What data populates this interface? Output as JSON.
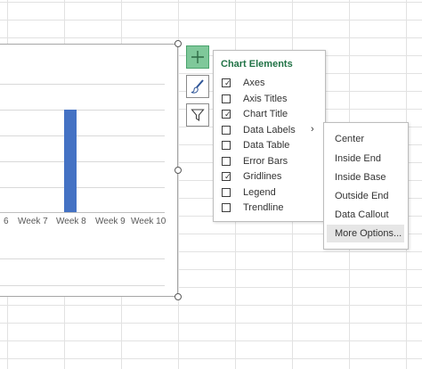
{
  "chart": {
    "x_ticks": [
      "6",
      "Week 7",
      "Week 8",
      "Week 9",
      "Week 10"
    ],
    "bar_color": "#4472c4",
    "bar_category": "Week 8"
  },
  "side_buttons": [
    {
      "name": "chart-elements-button",
      "icon": "plus-icon",
      "active": true
    },
    {
      "name": "chart-styles-button",
      "icon": "paintbrush-icon",
      "active": false
    },
    {
      "name": "chart-filters-button",
      "icon": "funnel-icon",
      "active": false
    }
  ],
  "panel": {
    "title": "Chart Elements",
    "title_color": "#217346",
    "items": [
      {
        "label": "Axes",
        "checked": true,
        "highlight": true
      },
      {
        "label": "Axis Titles",
        "checked": false,
        "highlight": false
      },
      {
        "label": "Chart Title",
        "checked": true,
        "highlight": true
      },
      {
        "label": "Data Labels",
        "checked": false,
        "highlight": false
      },
      {
        "label": "Data Table",
        "checked": false,
        "highlight": false
      },
      {
        "label": "Error Bars",
        "checked": false,
        "highlight": false
      },
      {
        "label": "Gridlines",
        "checked": true,
        "highlight": true
      },
      {
        "label": "Legend",
        "checked": false,
        "highlight": false
      },
      {
        "label": "Trendline",
        "checked": false,
        "highlight": false
      }
    ],
    "submenu_arrow": "›"
  },
  "submenu": {
    "items": [
      "Center",
      "Inside End",
      "Inside Base",
      "Outside End",
      "Data Callout",
      "More Options..."
    ],
    "hovered": "More Options..."
  }
}
